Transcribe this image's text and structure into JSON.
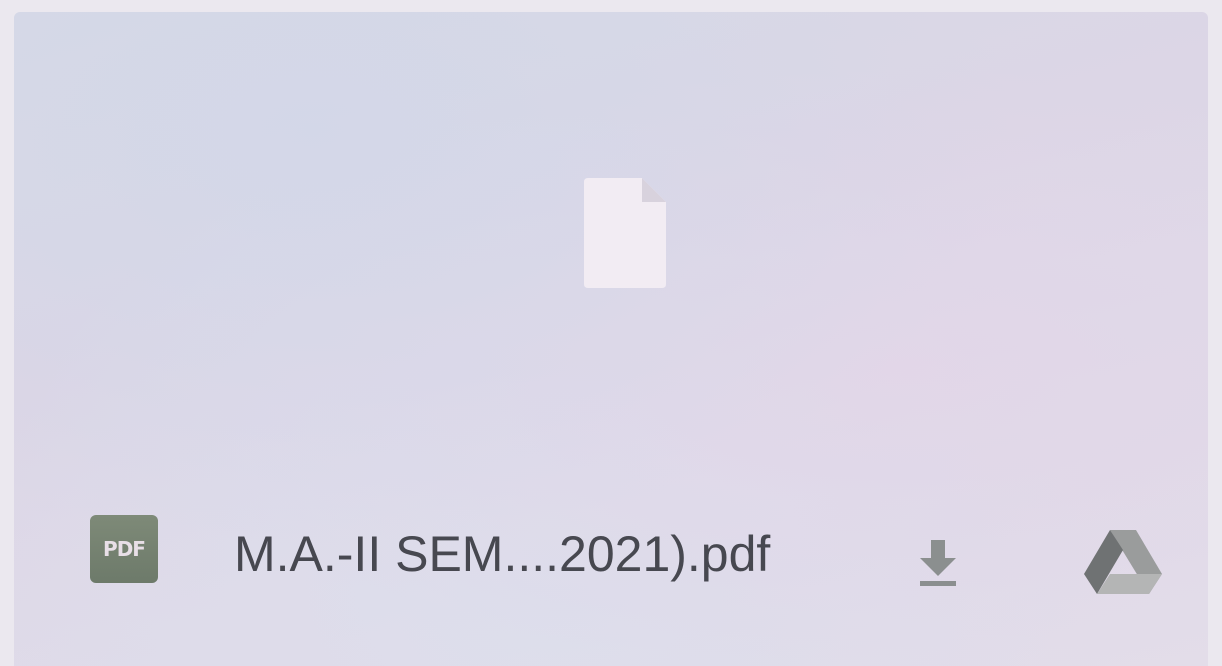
{
  "file": {
    "name": "M.A.-II SEM....2021).pdf",
    "type_badge": "PDF"
  },
  "icons": {
    "preview": "file-icon",
    "type": "pdf-icon",
    "download": "download-icon",
    "drive": "google-drive-icon"
  },
  "colors": {
    "background": "#dcd9e8",
    "badge": "#76826f",
    "text": "#474850",
    "icon": "#8a8d8f"
  }
}
